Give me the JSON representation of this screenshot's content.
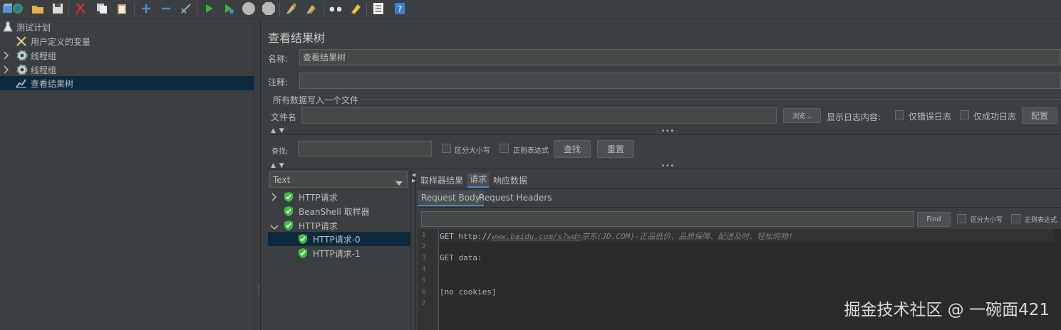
{
  "toolbar": {
    "icons": [
      "templates-icon",
      "open-icon",
      "save-icon",
      "cut-icon",
      "copy-icon",
      "paste-icon",
      "expand-icon",
      "collapse-icon",
      "toggle-icon",
      "start-icon",
      "start-no-pause-icon",
      "stop-icon",
      "shutdown-icon",
      "clear-icon",
      "clear-all-icon",
      "search-icon",
      "reset-search-icon",
      "function-helper-icon",
      "help-icon"
    ]
  },
  "tree": {
    "items": [
      {
        "label": "测试计划",
        "icon": "flask-icon"
      },
      {
        "label": "用户定义的变量",
        "icon": "wrench-icon"
      },
      {
        "label": "线程组",
        "icon": "gear-icon"
      },
      {
        "label": "线程组",
        "icon": "gear-icon"
      },
      {
        "label": "查看结果树",
        "icon": "chart-icon"
      }
    ]
  },
  "panel": {
    "title": "查看结果树",
    "name_label": "名称:",
    "name_value": "查看结果树",
    "comment_label": "注释:",
    "comment_value": "",
    "write_all_label": "所有数据写入一个文件",
    "filename_label": "文件名",
    "filename_value": "",
    "browse_label": "浏览...",
    "log_content_label": "显示日志内容:",
    "errors_only_label": "仅错误日志",
    "success_only_label": "仅成功日志",
    "configure_label": "配置"
  },
  "search": {
    "label": "查找:",
    "value": "",
    "case_sensitive_label": "区分大小写",
    "regex_label": "正则表达式",
    "find_label": "查找",
    "reset_label": "重置"
  },
  "renderer": {
    "selected": "Text"
  },
  "results": [
    {
      "label": "HTTP请求"
    },
    {
      "label": "BeanShell 取样器"
    },
    {
      "label": "HTTP请求"
    },
    {
      "label": "HTTP请求-0"
    },
    {
      "label": "HTTP请求-1"
    }
  ],
  "tabs": {
    "sampler_result": "取样器结果",
    "request": "请求",
    "response_data": "响应数据",
    "request_body": "Request Body",
    "request_headers": "Request Headers"
  },
  "body_search": {
    "value": "",
    "find_label": "Find",
    "case_sensitive_label": "区分大小写",
    "regex_label": "正则表达式"
  },
  "code": {
    "lines": [
      {
        "n": "1",
        "prefix": "GET http://",
        "url": "www.baidu.com/s?wd=",
        "rest": "京东(JD.COM)-正品低价、品质保障、配送及时、轻松购物!"
      },
      {
        "n": "2",
        "text": ""
      },
      {
        "n": "3",
        "text": "GET data:"
      },
      {
        "n": "4",
        "text": ""
      },
      {
        "n": "5",
        "text": ""
      },
      {
        "n": "6",
        "text": "[no cookies]"
      },
      {
        "n": "7",
        "text": ""
      }
    ]
  },
  "watermark": "掘金技术社区 @ 一碗面421",
  "colors": {
    "background": "#3c3f41",
    "selection": "#0d293e",
    "accent": "#4a88c7",
    "success": "#3fbf3f"
  }
}
